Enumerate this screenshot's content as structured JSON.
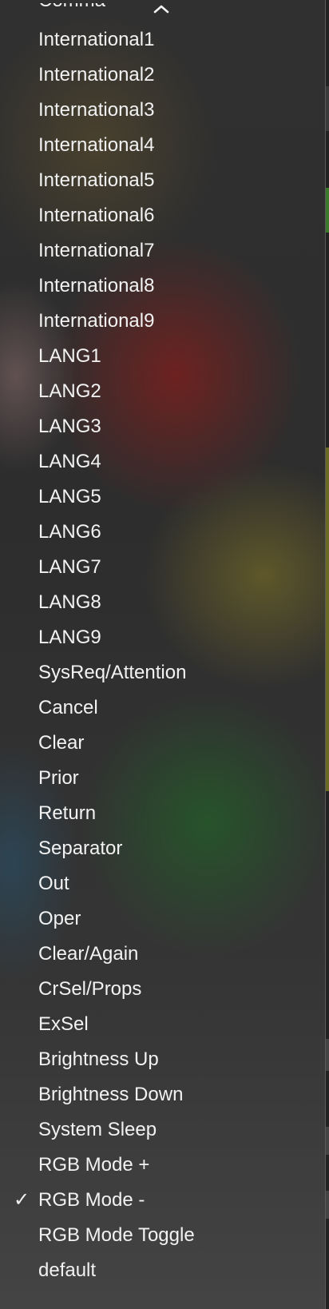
{
  "menu": {
    "scroll_up_icon": "chevron-up-icon",
    "clipped_item": "Comma",
    "items": [
      {
        "label": "International1"
      },
      {
        "label": "International2"
      },
      {
        "label": "International3"
      },
      {
        "label": "International4"
      },
      {
        "label": "International5"
      },
      {
        "label": "International6"
      },
      {
        "label": "International7"
      },
      {
        "label": "International8"
      },
      {
        "label": "International9"
      },
      {
        "label": "LANG1"
      },
      {
        "label": "LANG2"
      },
      {
        "label": "LANG3"
      },
      {
        "label": "LANG4"
      },
      {
        "label": "LANG5"
      },
      {
        "label": "LANG6"
      },
      {
        "label": "LANG7"
      },
      {
        "label": "LANG8"
      },
      {
        "label": "LANG9"
      },
      {
        "label": "SysReq/Attention"
      },
      {
        "label": "Cancel"
      },
      {
        "label": "Clear"
      },
      {
        "label": "Prior"
      },
      {
        "label": "Return"
      },
      {
        "label": "Separator"
      },
      {
        "label": "Out"
      },
      {
        "label": "Oper"
      },
      {
        "label": "Clear/Again"
      },
      {
        "label": "CrSel/Props"
      },
      {
        "label": "ExSel"
      },
      {
        "label": "Brightness Up"
      },
      {
        "label": "Brightness Down"
      },
      {
        "label": "System Sleep"
      },
      {
        "label": "RGB Mode +"
      },
      {
        "label": "RGB Mode -",
        "checked": true,
        "check_glyph": "✓"
      },
      {
        "label": "RGB Mode Toggle"
      },
      {
        "label": "default"
      }
    ]
  }
}
